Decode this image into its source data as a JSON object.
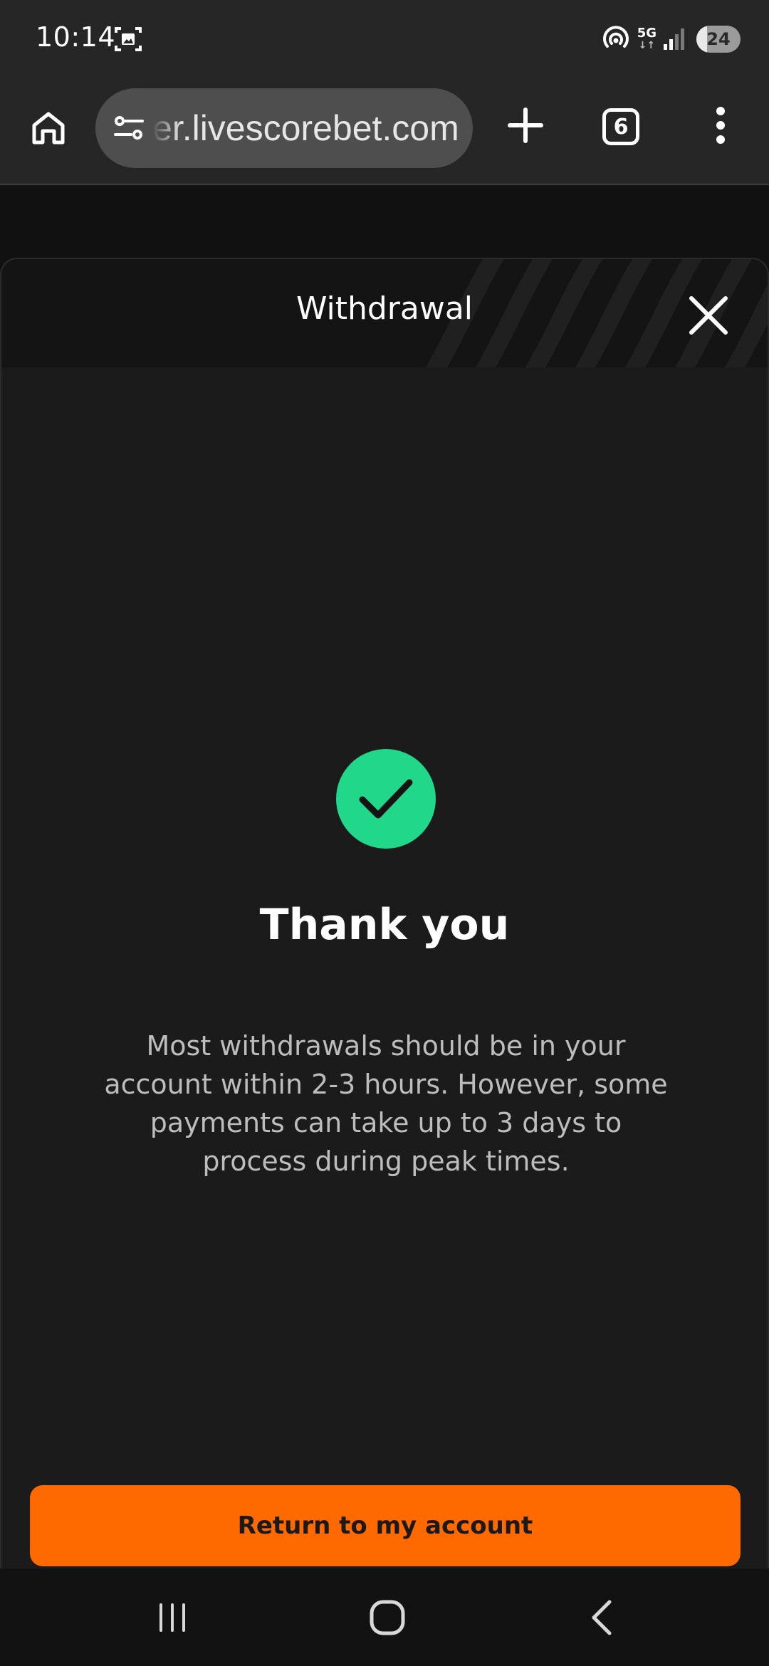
{
  "status_bar": {
    "time": "10:14",
    "network": "5G",
    "network_arrows": "↓↑",
    "battery": "24",
    "icons": [
      "screenshot-icon",
      "hotspot-icon",
      "signal-icon",
      "battery-icon"
    ]
  },
  "browser": {
    "url": "er.livescorebet.com",
    "tab_count": "6",
    "icons": [
      "home-icon",
      "site-settings-icon",
      "plus-icon",
      "tabs-icon",
      "more-vert-icon"
    ]
  },
  "modal": {
    "title": "Withdrawal",
    "close_icon": "close-icon"
  },
  "confirmation": {
    "icon": "check-icon",
    "icon_color": "#21d88a",
    "title": "Thank you",
    "message": "Most withdrawals should be in your account within 2-3 hours. However, some payments can take up to 3 days to process during peak times."
  },
  "actions": {
    "return_label": "Return to my account",
    "accent_color": "#ff6a00"
  },
  "nav_bar": {
    "icons": [
      "recents-icon",
      "home-icon",
      "back-icon"
    ]
  }
}
